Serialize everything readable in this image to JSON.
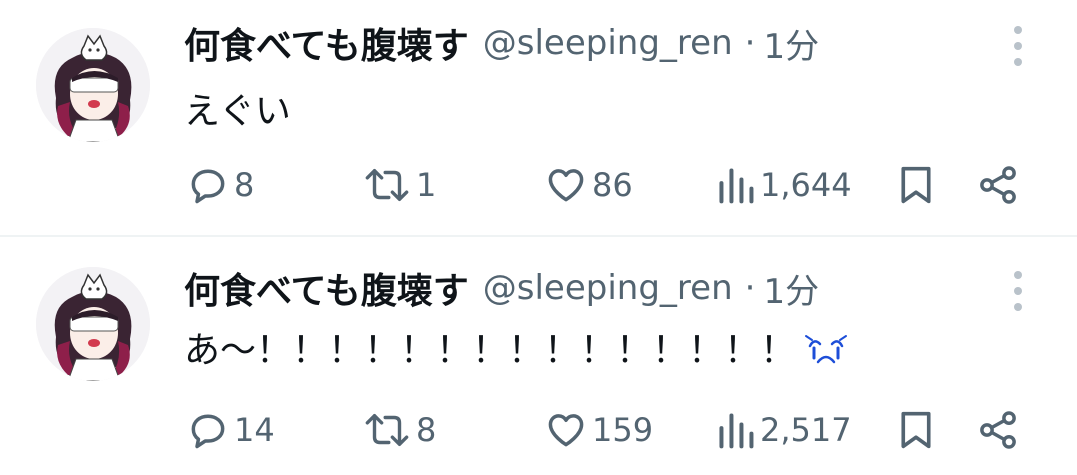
{
  "tweets": [
    {
      "display_name": "何食べても腹壊す",
      "handle": "@sleeping_ren",
      "dot": "·",
      "time": "1分",
      "text": "えぐい",
      "replies": "8",
      "retweets": "1",
      "likes": "86",
      "views": "1,644",
      "has_emoji": false
    },
    {
      "display_name": "何食べても腹壊す",
      "handle": "@sleeping_ren",
      "dot": "·",
      "time": "1分",
      "text": "あ〜！！！！！！！！！！！！！！！",
      "replies": "14",
      "retweets": "8",
      "likes": "159",
      "views": "2,517",
      "has_emoji": true,
      "emoji_icon": "crying-face-icon"
    }
  ],
  "colors": {
    "text_primary": "#0f1419",
    "text_secondary": "#536471",
    "divider": "#eff3f4",
    "emoji_blue": "#1d4ed8"
  }
}
